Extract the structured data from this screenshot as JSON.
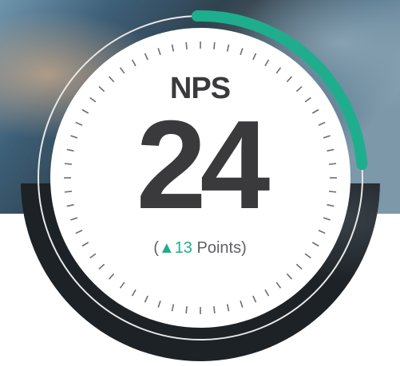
{
  "gauge": {
    "label": "NPS",
    "score": "24",
    "change": {
      "open": "(",
      "arrow": "▲",
      "value": "13",
      "unit": "Points",
      "close": ")"
    },
    "progress_fraction": 0.24
  },
  "colors": {
    "accent": "#1fae8d",
    "text": "#3a3a3c",
    "ticks": "#6e6e72",
    "dial": "#ffffff"
  }
}
